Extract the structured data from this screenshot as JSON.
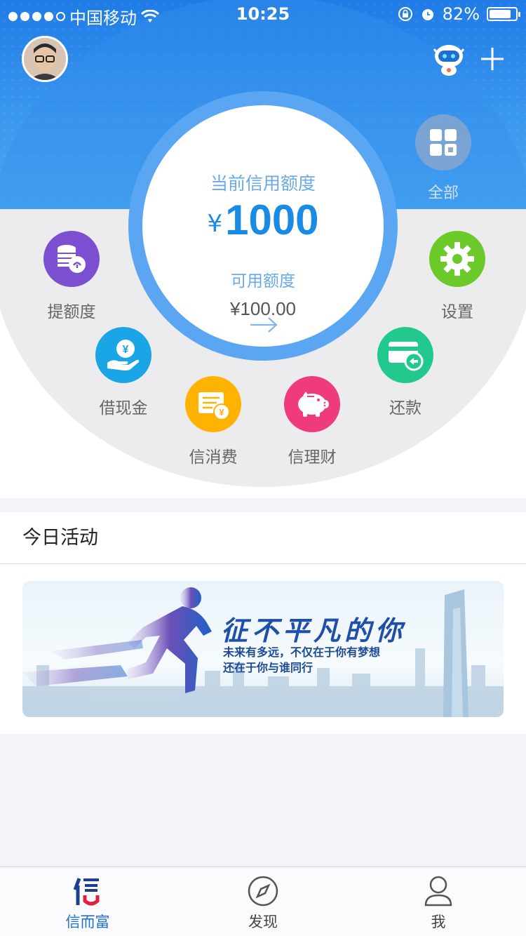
{
  "status_bar": {
    "carrier": "中国移动",
    "time": "10:25",
    "battery_text": "82%",
    "battery_level": 0.82
  },
  "header": {
    "all_label": "全部"
  },
  "credit": {
    "label": "当前信用额度",
    "currency": "¥",
    "amount": "1000",
    "available_label": "可用额度",
    "available_amount": "¥100.00"
  },
  "menu": {
    "raise_limit": "提额度",
    "cash_loan": "借现金",
    "consume": "信消费",
    "finance": "信理财",
    "repay": "还款",
    "settings": "设置"
  },
  "activity": {
    "title": "今日活动",
    "banner_title": "征不平凡的你",
    "banner_line1": "未来有多远，不仅在于你有梦想",
    "banner_line2": "还在于你与谁同行"
  },
  "tabbar": {
    "home": "信而富",
    "discover": "发现",
    "me": "我"
  },
  "colors": {
    "accent": "#1a8be5",
    "purple": "#7b4fd0",
    "cyan": "#1aa6e6",
    "orange": "#ffb300",
    "pink": "#f03a7e",
    "teal": "#22c98c",
    "green": "#6cc92a"
  }
}
